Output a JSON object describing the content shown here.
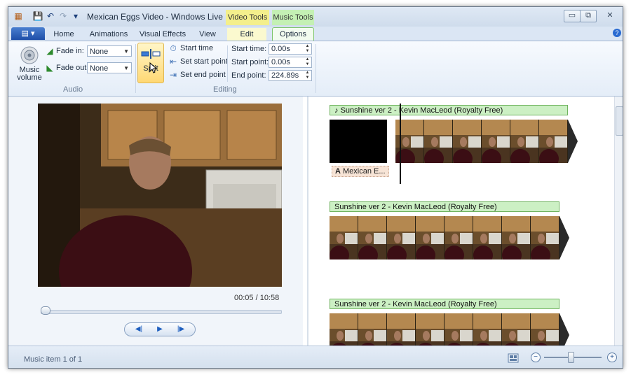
{
  "window": {
    "title": "Mexican Eggs Video - Windows Live Movi...",
    "context_tabs": [
      "Video Tools",
      "Music Tools"
    ],
    "controls": {
      "minimize": "▭",
      "restore": "⧉",
      "close": "✕"
    }
  },
  "quick_access": {
    "save": "💾",
    "undo": "↶",
    "redo": "↷",
    "more": "▾"
  },
  "ribbon_tabs": {
    "file": "▤ ▾",
    "items": [
      "Home",
      "Animations",
      "Visual Effects",
      "View",
      "Edit",
      "Options"
    ],
    "active": "Options",
    "help": "?"
  },
  "ribbon": {
    "audio": {
      "group_label": "Audio",
      "music_volume_label": "Music volume",
      "fade_in_label": "Fade in:",
      "fade_in_value": "None",
      "fade_out_label": "Fade out:",
      "fade_out_value": "None"
    },
    "editing": {
      "group_label": "Editing",
      "split_label": "Split",
      "set_start_time": "Start time",
      "set_start_point": "Set start point",
      "set_end_point": "Set end point",
      "start_time_label": "Start time:",
      "start_time_value": "0.00s",
      "start_point_label": "Start point:",
      "start_point_value": "0.00s",
      "end_point_label": "End point:",
      "end_point_value": "224.89s"
    }
  },
  "preview": {
    "timecode": "00:05 / 10:58",
    "seek_progress": 0.005,
    "transport": {
      "prev": "◀|",
      "play": "▶",
      "next": "|▶"
    }
  },
  "storyboard": {
    "tracks": [
      {
        "music_label": "Sunshine ver 2 - Kevin MacLeod (Royalty Free)",
        "caption": "Mexican E..."
      },
      {
        "music_label": "Sunshine ver 2 - Kevin MacLeod (Royalty Free)"
      },
      {
        "music_label": "Sunshine ver 2 - Kevin MacLeod (Royalty Free)"
      }
    ]
  },
  "status": {
    "text": "Music item 1 of 1",
    "zoom_minus": "−",
    "zoom_plus": "+",
    "zoom_level": 0.45
  },
  "colors": {
    "music_bar": "#ccf0c4",
    "music_border": "#6fb35f",
    "video_tools": "#f4ef8c",
    "music_tools": "#c4f0b4",
    "accent": "#1e4fa8"
  }
}
